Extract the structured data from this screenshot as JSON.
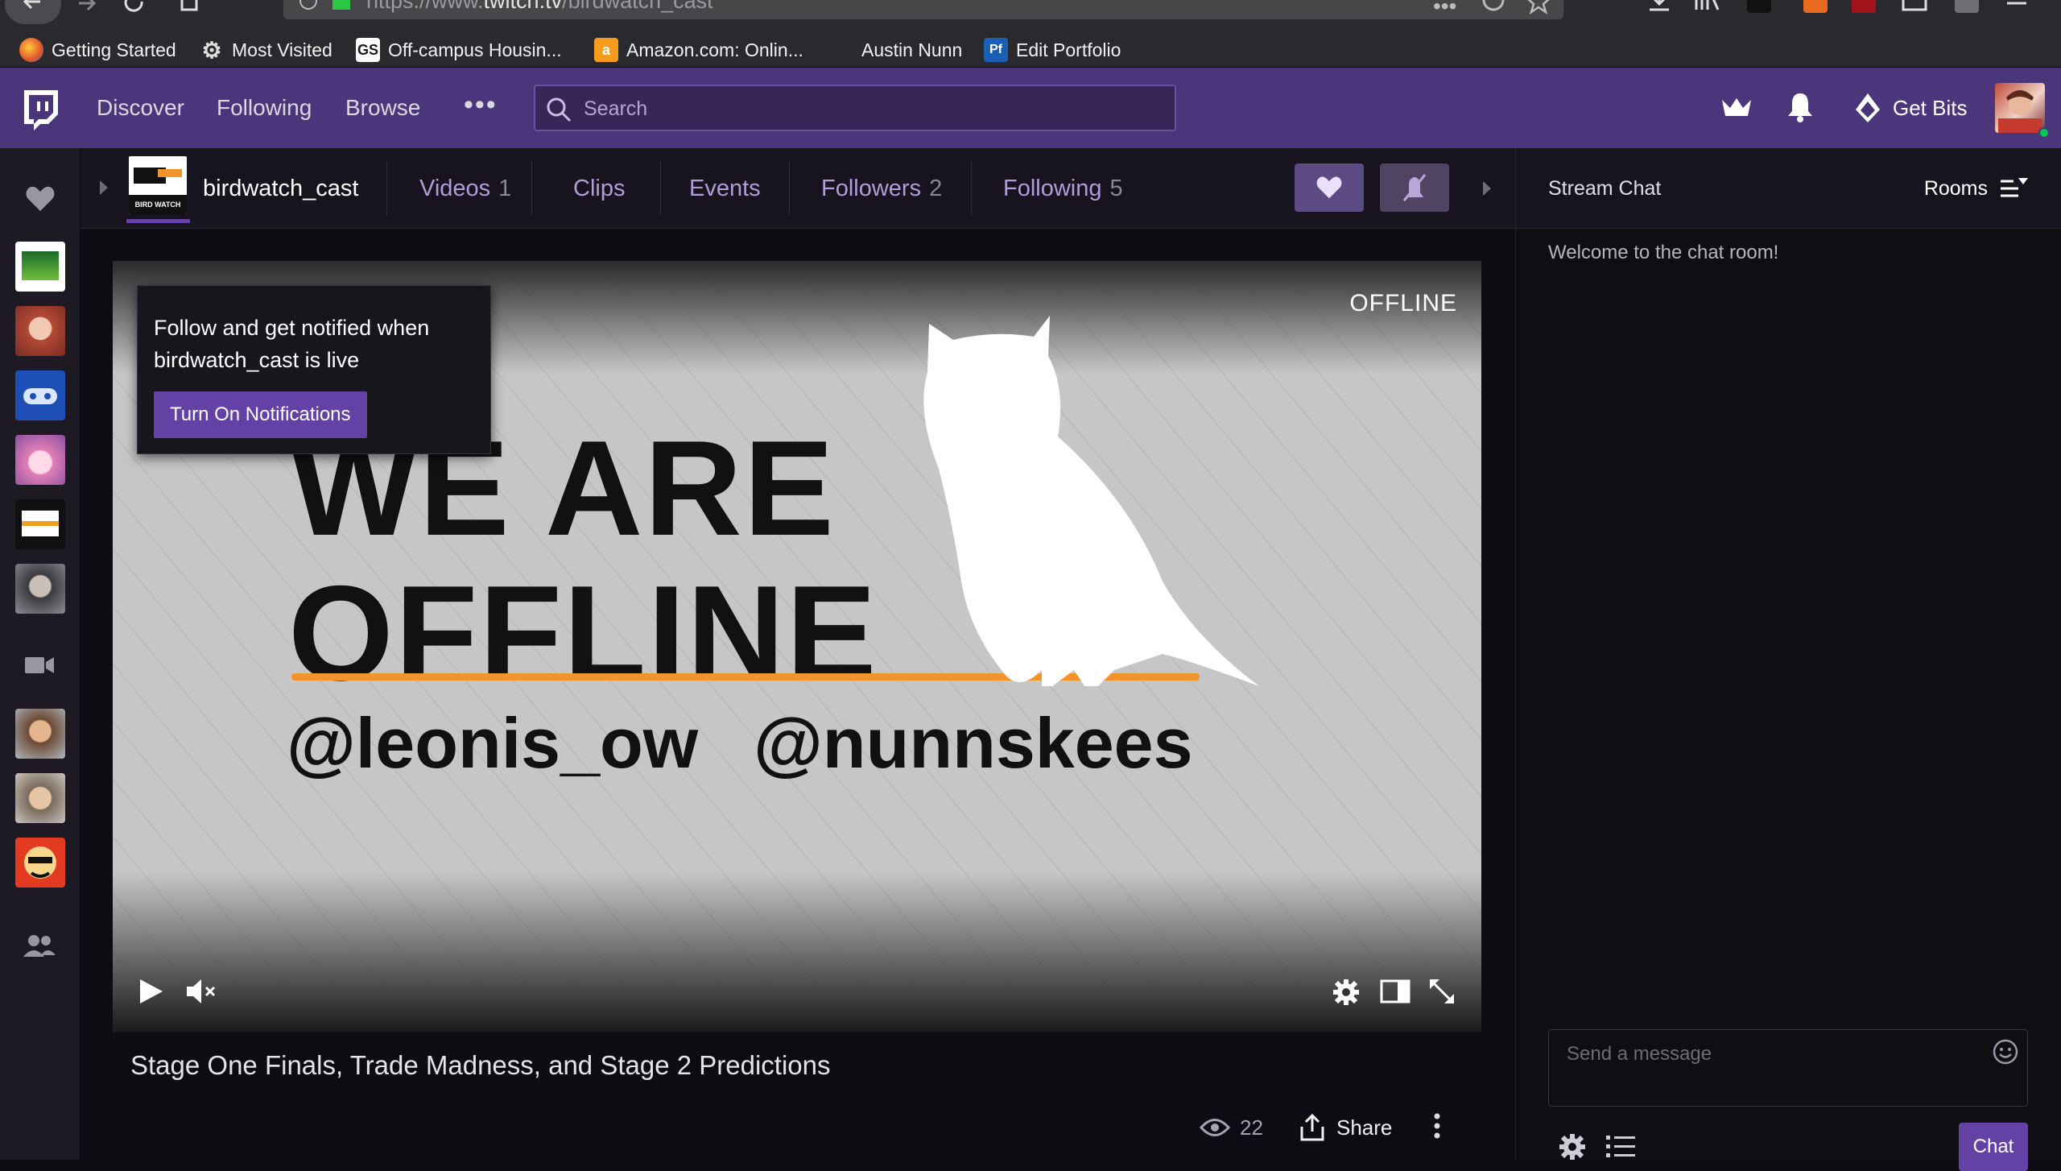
{
  "browser": {
    "url_prefix": "https://www.",
    "url_host": "twitch.tv",
    "url_path": "/birdwatch_cast",
    "bookmarks": [
      {
        "label": "Getting Started"
      },
      {
        "label": "Most Visited"
      },
      {
        "label": "Off-campus Housin...",
        "icon_text": "GS"
      },
      {
        "label": "Amazon.com: Onlin...",
        "icon_text": "a"
      },
      {
        "label": "Austin Nunn"
      },
      {
        "label": "Edit Portfolio",
        "icon_text": "Pf"
      }
    ]
  },
  "topnav": {
    "links": [
      "Discover",
      "Following",
      "Browse"
    ],
    "search_placeholder": "Search",
    "get_bits": "Get Bits"
  },
  "channel": {
    "name": "birdwatch_cast",
    "logo_text": "BIRD WATCH",
    "tabs": [
      {
        "label": "Videos",
        "count": "1"
      },
      {
        "label": "Clips",
        "count": ""
      },
      {
        "label": "Events",
        "count": ""
      },
      {
        "label": "Followers",
        "count": "2"
      },
      {
        "label": "Following",
        "count": "5"
      }
    ]
  },
  "player": {
    "status": "OFFLINE",
    "slide_line1": "WE ARE",
    "slide_line2": "OFFLINE",
    "handle1": "@leonis_ow",
    "handle2": "@nunnskees"
  },
  "notify": {
    "text": "Follow and get notified when birdwatch_cast is live",
    "button": "Turn On Notifications"
  },
  "stream": {
    "title": "Stage One Finals, Trade Madness, and Stage 2 Predictions",
    "viewers": "22",
    "share": "Share"
  },
  "chat": {
    "title": "Stream Chat",
    "rooms": "Rooms",
    "welcome": "Welcome to the chat room!",
    "placeholder": "Send a message",
    "button": "Chat"
  },
  "colors": {
    "twitch_purple": "#6441a4",
    "nav_bg": "#4b367c",
    "orange_underline": "#f2942c"
  }
}
